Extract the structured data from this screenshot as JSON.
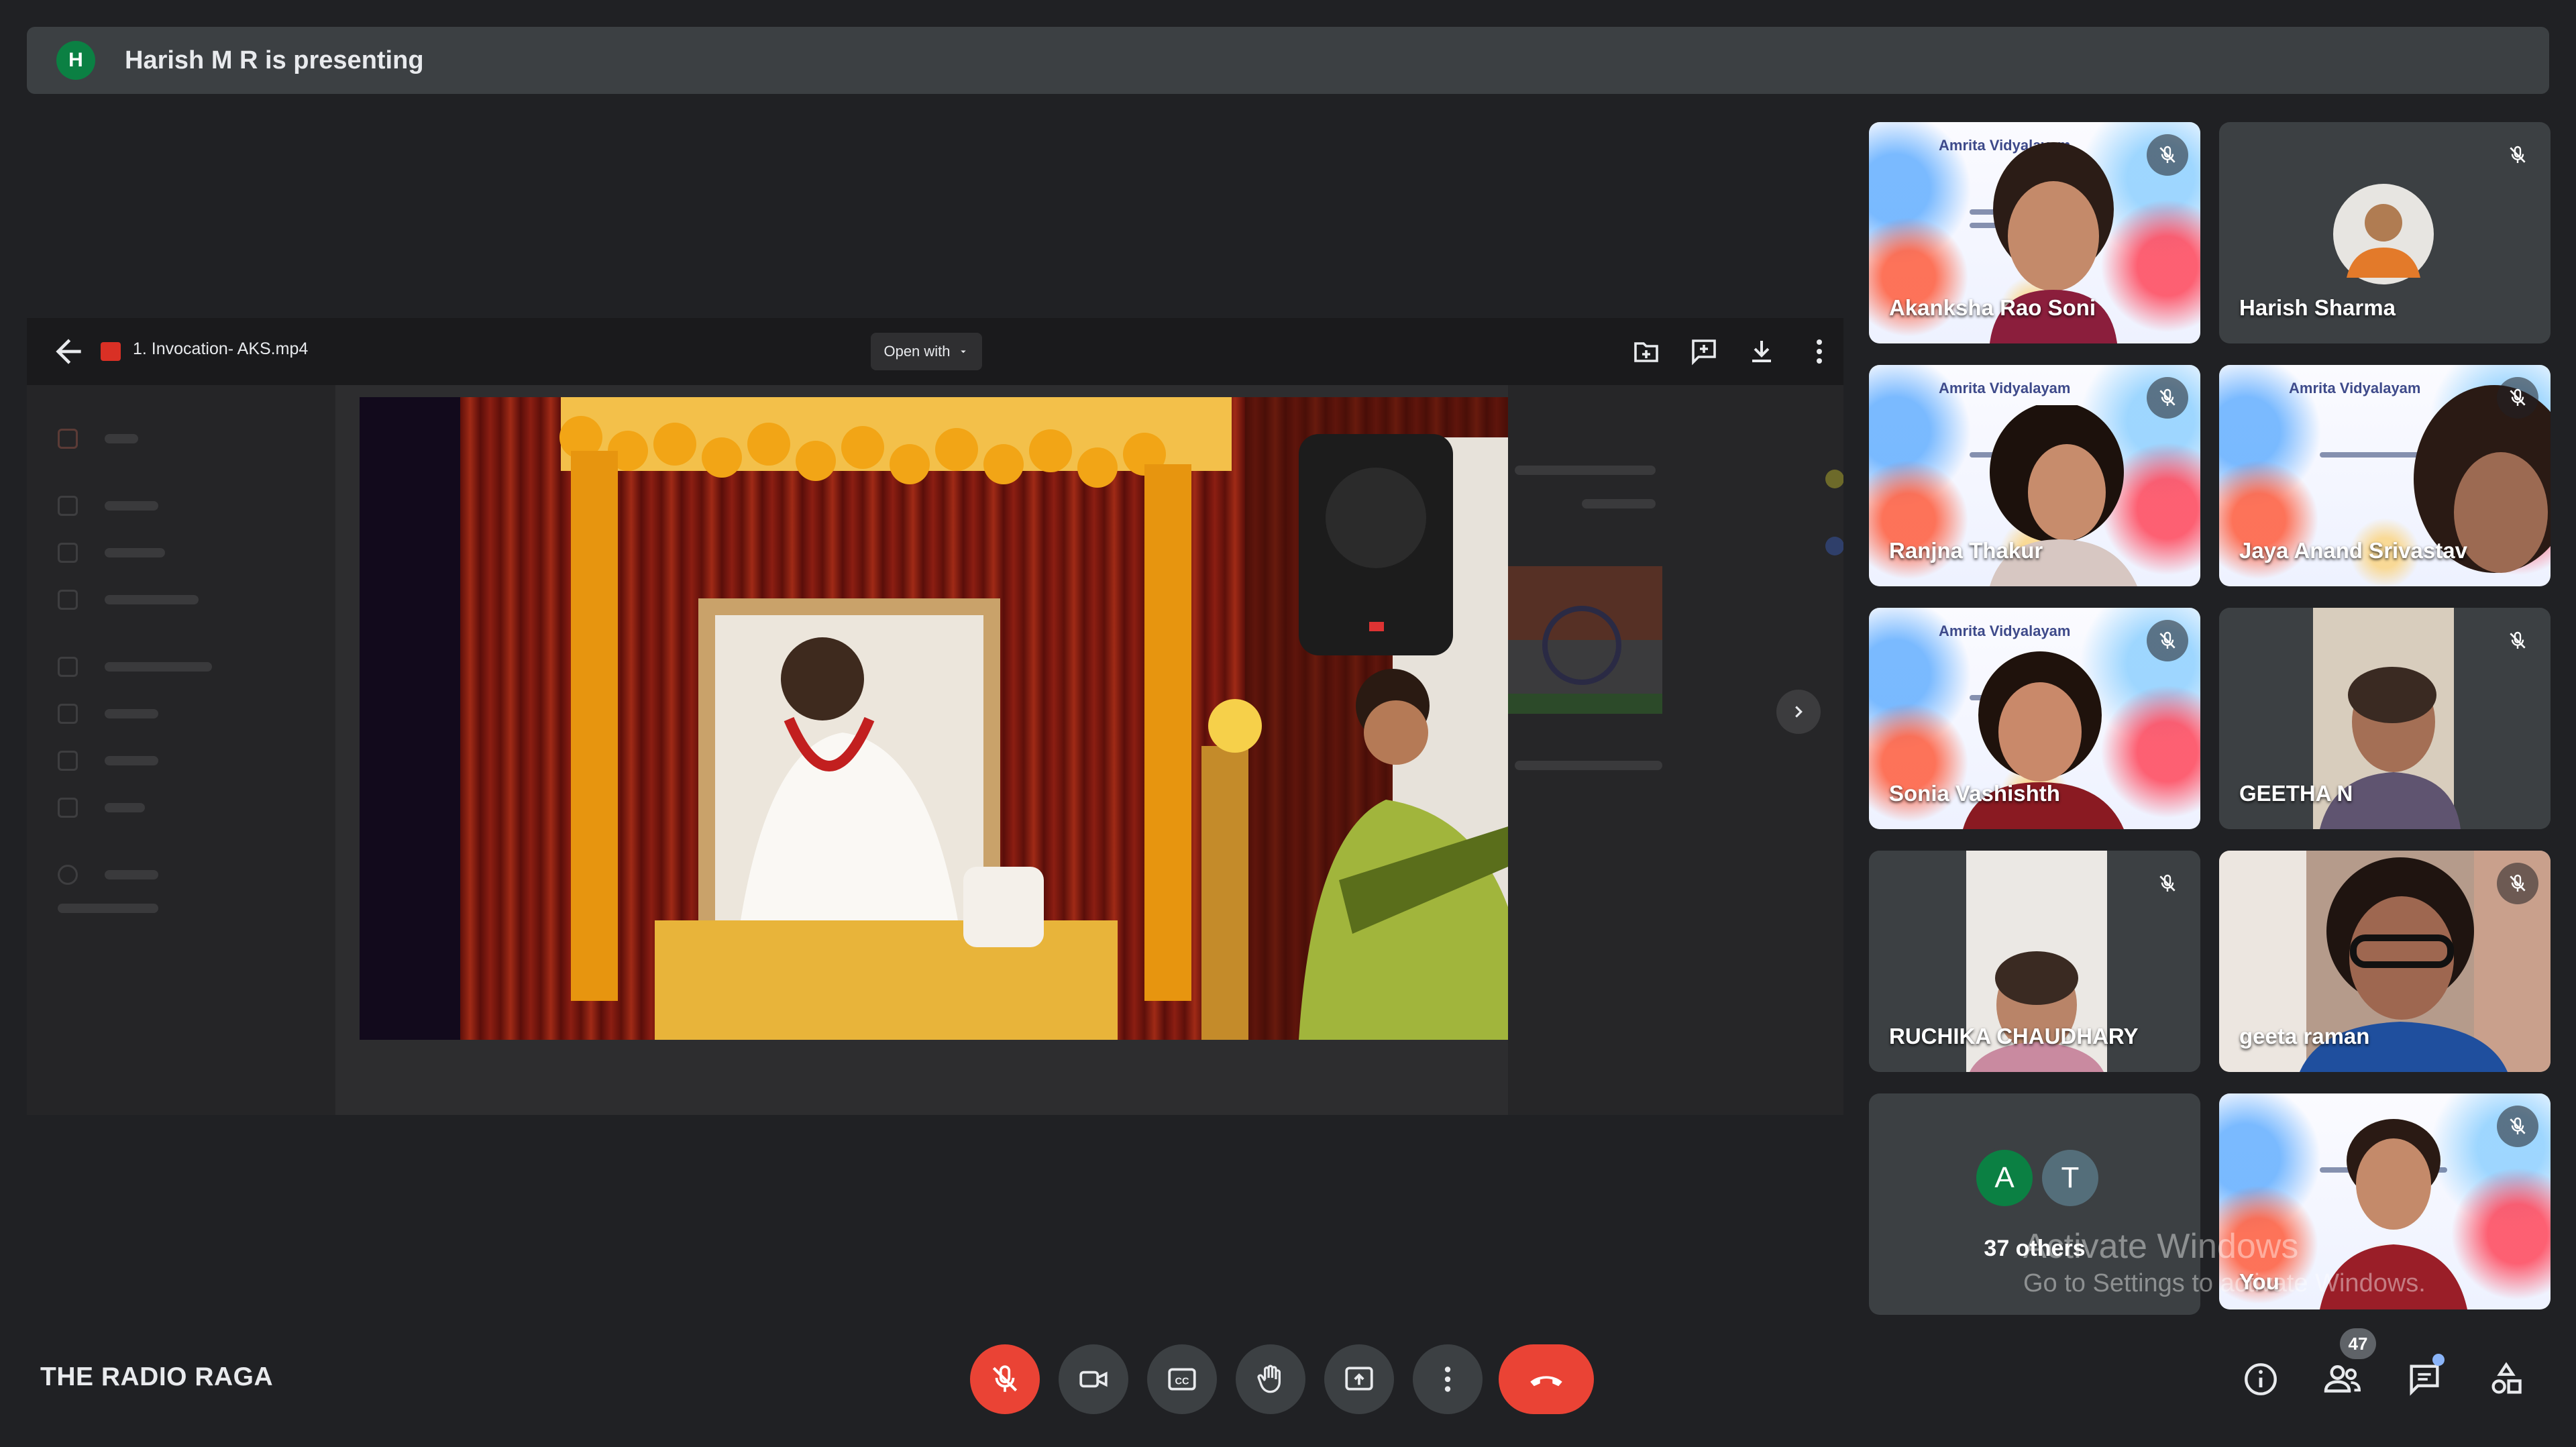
{
  "banner": {
    "avatar_letter": "H",
    "text": "Harish M R is presenting"
  },
  "shared_screen": {
    "file_name": "1. Invocation- AKS.mp4",
    "open_with_label": "Open with"
  },
  "participants": [
    {
      "name": "Akanksha Rao Soni",
      "muted": true
    },
    {
      "name": "Harish Sharma",
      "muted": true
    },
    {
      "name": "Ranjna Thakur",
      "muted": true
    },
    {
      "name": "Jaya Anand Srivastav",
      "muted": true
    },
    {
      "name": "Sonia Vashishth",
      "muted": true
    },
    {
      "name": "GEETHA N",
      "muted": true
    },
    {
      "name": "RUCHIKA CHAUDHARY",
      "muted": true
    },
    {
      "name": "geeta raman",
      "muted": true
    },
    {
      "name": "You",
      "muted": true
    }
  ],
  "poster_text": "Amrita Vidyalayam",
  "others": {
    "avatars": [
      {
        "letter": "A",
        "color": "#0b8043"
      },
      {
        "letter": "T",
        "color": "#546e7a"
      }
    ],
    "label": "37 others"
  },
  "watermark": {
    "line1": "Activate Windows",
    "line2": "Go to Settings to activate Windows."
  },
  "bottom_bar": {
    "meeting_name": "THE RADIO RAGA",
    "people_count": "47"
  },
  "colors": {
    "background": "#202124",
    "tile": "#3c4043",
    "danger": "#ea4335",
    "accent": "#8ab4f8"
  }
}
